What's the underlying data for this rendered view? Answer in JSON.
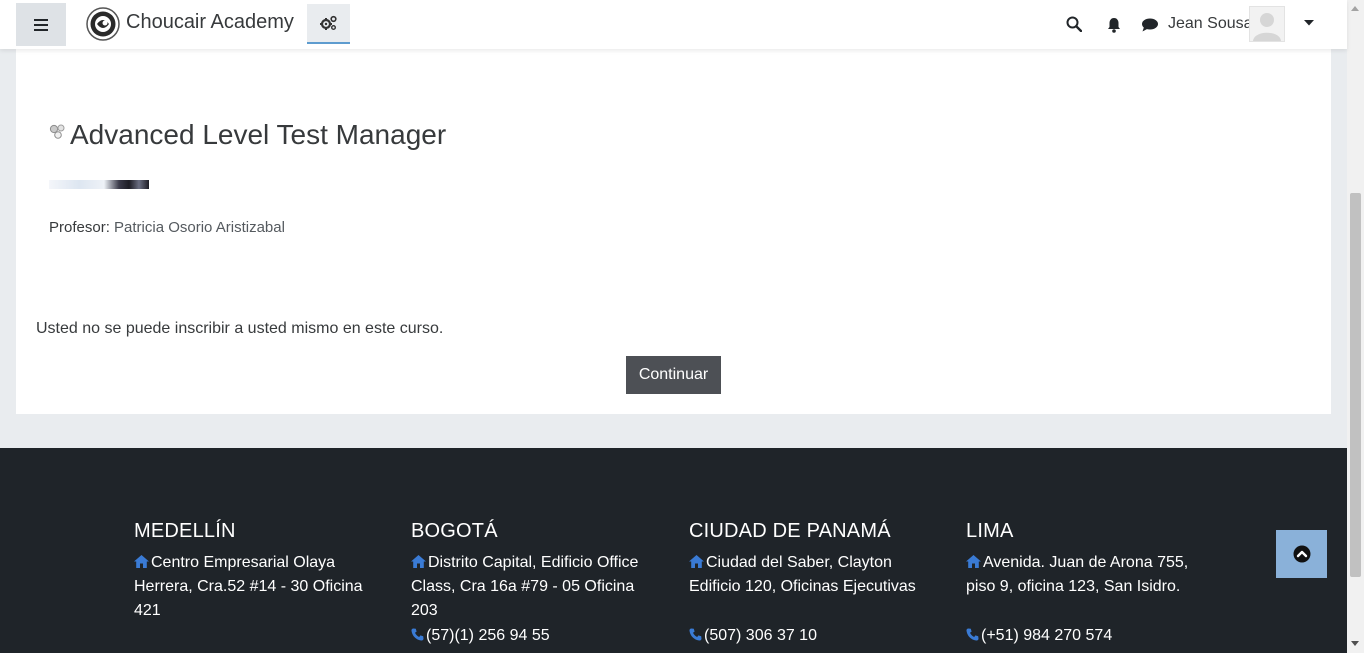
{
  "navbar": {
    "site_name": "Choucair Academy",
    "user_name": "Jean Sousa",
    "icons": [
      "hamburger-icon",
      "logo",
      "cogs-icon",
      "search-icon",
      "bell-icon",
      "chat-icon",
      "caret-down-icon"
    ]
  },
  "course": {
    "title": "Advanced Level Test Manager",
    "teacher_label": "Profesor:",
    "teacher_name": "Patricia Osorio Aristizabal"
  },
  "enrol": {
    "notice": "Usted no se puede inscribir a usted mismo en este curso.",
    "continue_label": "Continuar"
  },
  "footer": {
    "offices": [
      {
        "city": "MEDELLÍN",
        "address": "Centro Empresarial Olaya Herrera, Cra.52 #14 - 30 Oficina 421",
        "phone": ""
      },
      {
        "city": "BOGOTÁ",
        "address": "Distrito Capital, Edificio Office Class, Cra 16a #79 - 05 Oficina 203",
        "phone": "(57)(1) 256 94 55"
      },
      {
        "city": "CIUDAD DE PANAMÁ",
        "address": "Ciudad del Saber, Clayton Edificio 120, Oficinas Ejecutivas",
        "phone": "(507) 306 37 10"
      },
      {
        "city": "LIMA",
        "address": "Avenida. Juan de Arona 755, piso 9, oficina 123, San Isidro.",
        "phone": "(+51) 984 270 574"
      }
    ]
  },
  "colors": {
    "navbar_bg": "#ffffff",
    "page_bg": "#e9ecef",
    "footer_bg": "#1f2429",
    "accent_blue": "#3a7bd5",
    "button_bg": "#4d5055",
    "back_to_top_bg": "#8ab1d9"
  }
}
